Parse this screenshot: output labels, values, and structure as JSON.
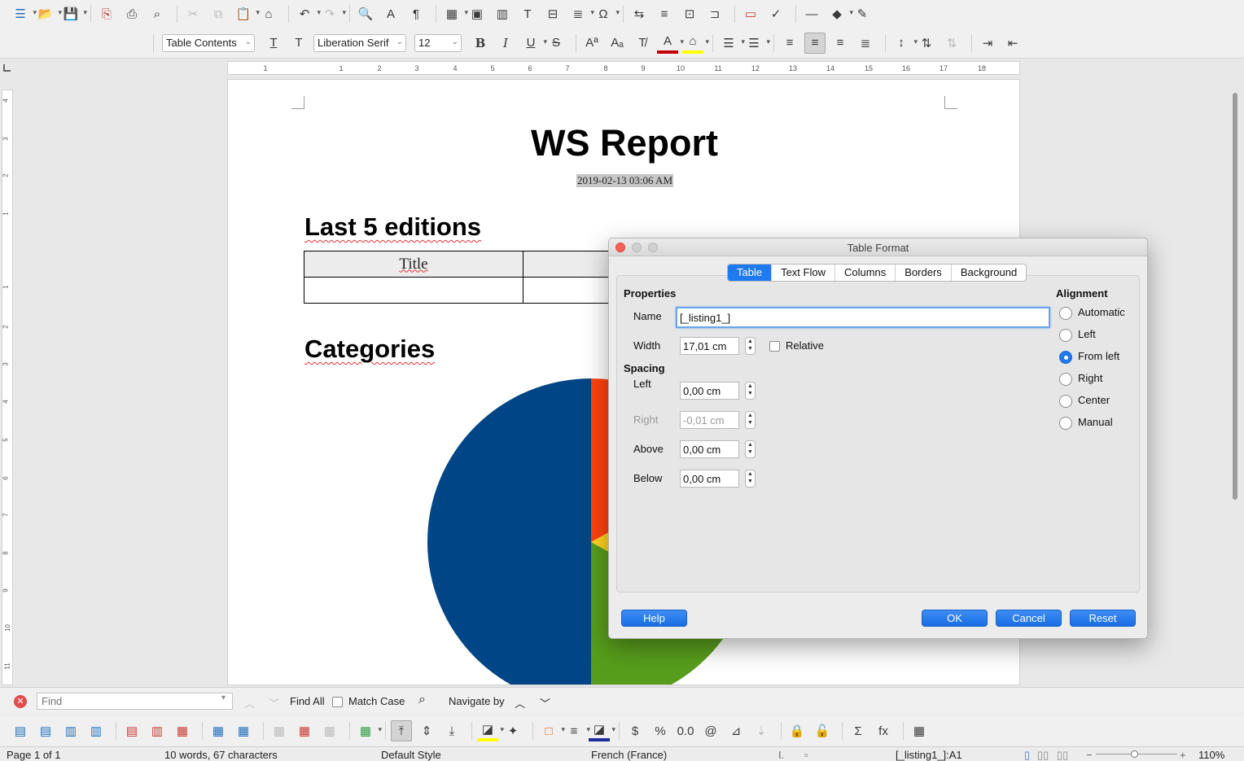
{
  "formatting": {
    "paragraph_style": "Table Contents",
    "font_name": "Liberation Serif",
    "font_size": "12"
  },
  "ruler": {
    "h_ticks": [
      "1",
      "1",
      "2",
      "3",
      "4",
      "5",
      "6",
      "7",
      "8",
      "9",
      "10",
      "11",
      "12",
      "13",
      "14",
      "15",
      "16",
      "17",
      "18"
    ],
    "v_ticks": [
      "4",
      "3",
      "2",
      "1",
      "1",
      "2",
      "3",
      "4",
      "5",
      "6",
      "7",
      "8",
      "9",
      "10",
      "11"
    ]
  },
  "document": {
    "title": "WS Report",
    "date": "2019-02-13 03:06 AM",
    "section1_heading": "Last 5 editions",
    "table_header": "Title",
    "section2_heading": "Categories"
  },
  "chart_data": {
    "type": "pie",
    "slices": [
      {
        "value": 50.0,
        "color": "#004586"
      },
      {
        "value": 17.0,
        "color": "#ff420e"
      },
      {
        "value": 16.0,
        "color": "#ffd320"
      },
      {
        "value": 17.0,
        "color": "#579d1c"
      }
    ]
  },
  "dialog": {
    "title": "Table Format",
    "tabs": [
      "Table",
      "Text Flow",
      "Columns",
      "Borders",
      "Background"
    ],
    "active_tab": "Table",
    "properties_heading": "Properties",
    "name_label": "Name",
    "name_value": "[_listing1_]",
    "width_label": "Width",
    "width_value": "17,01 cm",
    "relative_label": "Relative",
    "spacing_heading": "Spacing",
    "left_label": "Left",
    "left_value": "0,00 cm",
    "right_label": "Right",
    "right_value": "-0,01 cm",
    "above_label": "Above",
    "above_value": "0,00 cm",
    "below_label": "Below",
    "below_value": "0,00 cm",
    "alignment_heading": "Alignment",
    "alignment_options": [
      "Automatic",
      "Left",
      "From left",
      "Right",
      "Center",
      "Manual"
    ],
    "alignment_selected": "From left",
    "help_label": "Help",
    "ok_label": "OK",
    "cancel_label": "Cancel",
    "reset_label": "Reset"
  },
  "findbar": {
    "placeholder": "Find",
    "find_all_label": "Find All",
    "match_case_label": "Match Case",
    "navigate_label": "Navigate by"
  },
  "status": {
    "page": "Page 1 of 1",
    "words": "10 words, 67 characters",
    "page_style": "Default Style",
    "language": "French (France)",
    "cell": "[_listing1_]:A1",
    "zoom": "110%"
  },
  "colors": {
    "accent": "#1f7af0",
    "font_color": "#c00000",
    "highlight": "#ffff00"
  }
}
